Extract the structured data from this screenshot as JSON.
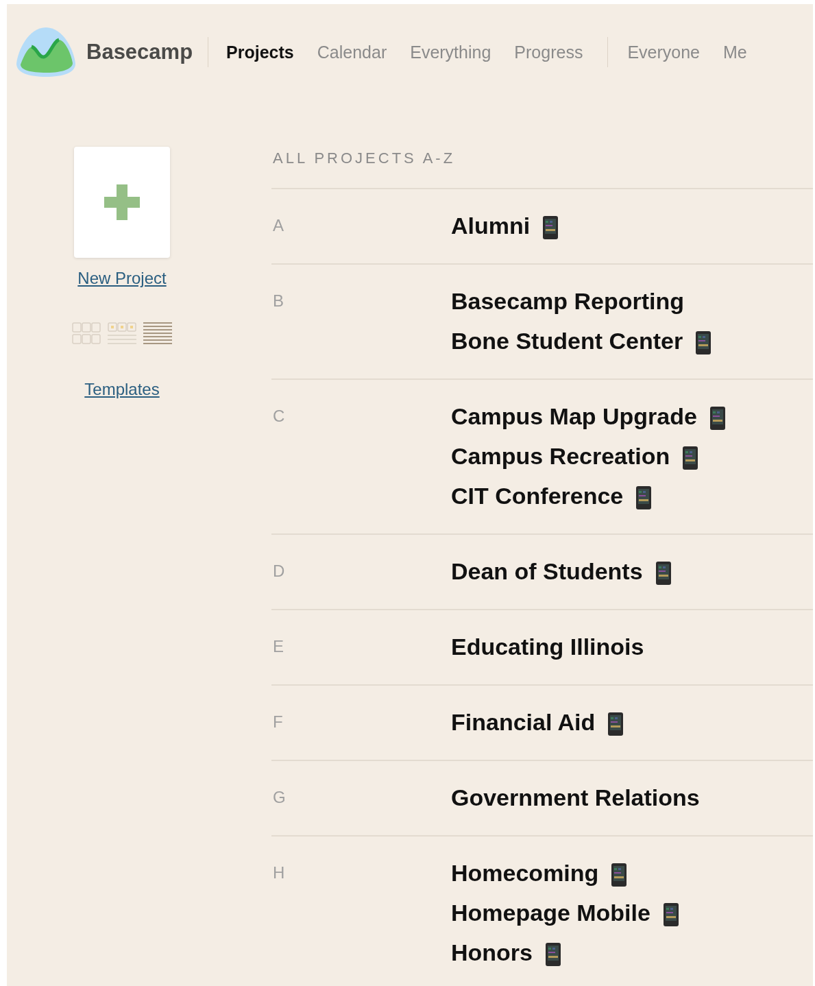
{
  "brand": "Basecamp",
  "nav": [
    {
      "label": "Projects",
      "selected": true
    },
    {
      "label": "Calendar",
      "selected": false
    },
    {
      "label": "Everything",
      "selected": false
    },
    {
      "label": "Progress",
      "selected": false
    }
  ],
  "people_nav": [
    {
      "label": "Everyone",
      "selected": false
    },
    {
      "label": "Me",
      "selected": false
    }
  ],
  "new_project": {
    "label": "New Project"
  },
  "view_modes": [
    {
      "kind": "grid",
      "selected": false
    },
    {
      "kind": "cards",
      "selected": false
    },
    {
      "kind": "list",
      "selected": true
    }
  ],
  "templates_link": "Templates",
  "heading": "ALL PROJECTS A-Z",
  "groups": [
    {
      "letter": "A",
      "projects": [
        {
          "name": "Alumni",
          "mobile": true
        }
      ]
    },
    {
      "letter": "B",
      "projects": [
        {
          "name": "Basecamp Reporting",
          "mobile": false
        },
        {
          "name": "Bone Student Center",
          "mobile": true
        }
      ]
    },
    {
      "letter": "C",
      "projects": [
        {
          "name": "Campus Map Upgrade",
          "mobile": true
        },
        {
          "name": "Campus Recreation",
          "mobile": true
        },
        {
          "name": "CIT Conference",
          "mobile": true
        }
      ]
    },
    {
      "letter": "D",
      "projects": [
        {
          "name": "Dean of Students",
          "mobile": true
        }
      ]
    },
    {
      "letter": "E",
      "projects": [
        {
          "name": "Educating Illinois",
          "mobile": false
        }
      ]
    },
    {
      "letter": "F",
      "projects": [
        {
          "name": "Financial Aid",
          "mobile": true
        }
      ]
    },
    {
      "letter": "G",
      "projects": [
        {
          "name": "Government Relations",
          "mobile": false
        }
      ]
    },
    {
      "letter": "H",
      "projects": [
        {
          "name": "Homecoming",
          "mobile": true
        },
        {
          "name": "Homepage Mobile",
          "mobile": true
        },
        {
          "name": "Honors",
          "mobile": true
        }
      ]
    }
  ]
}
